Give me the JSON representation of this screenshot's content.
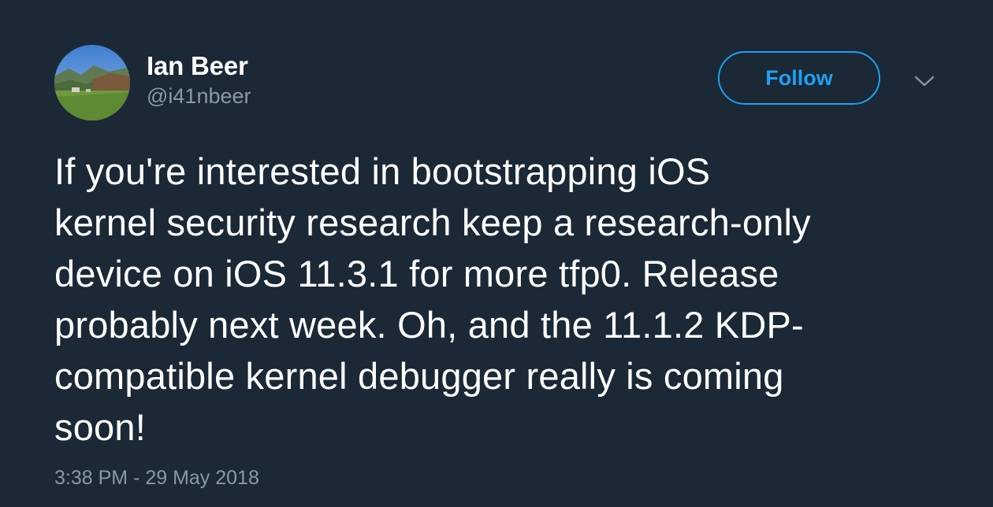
{
  "tweet": {
    "author": {
      "name": "Ian Beer",
      "handle": "@i41nbeer"
    },
    "follow_label": "Follow",
    "text_lines": [
      "If you're interested in bootstrapping iOS",
      "kernel security research keep a research-only",
      "device on iOS 11.3.1 for more tfp0. Release",
      "probably next week. Oh, and the 11.1.2 KDP-",
      "compatible kernel debugger really is coming",
      "soon!"
    ],
    "timestamp": "3:38 PM - 29 May 2018"
  },
  "icons": {
    "caret": "chevron-down-icon"
  },
  "colors": {
    "background": "#1b2836",
    "accent": "#1da1f2",
    "muted": "#8899a6",
    "text": "#ffffff"
  }
}
